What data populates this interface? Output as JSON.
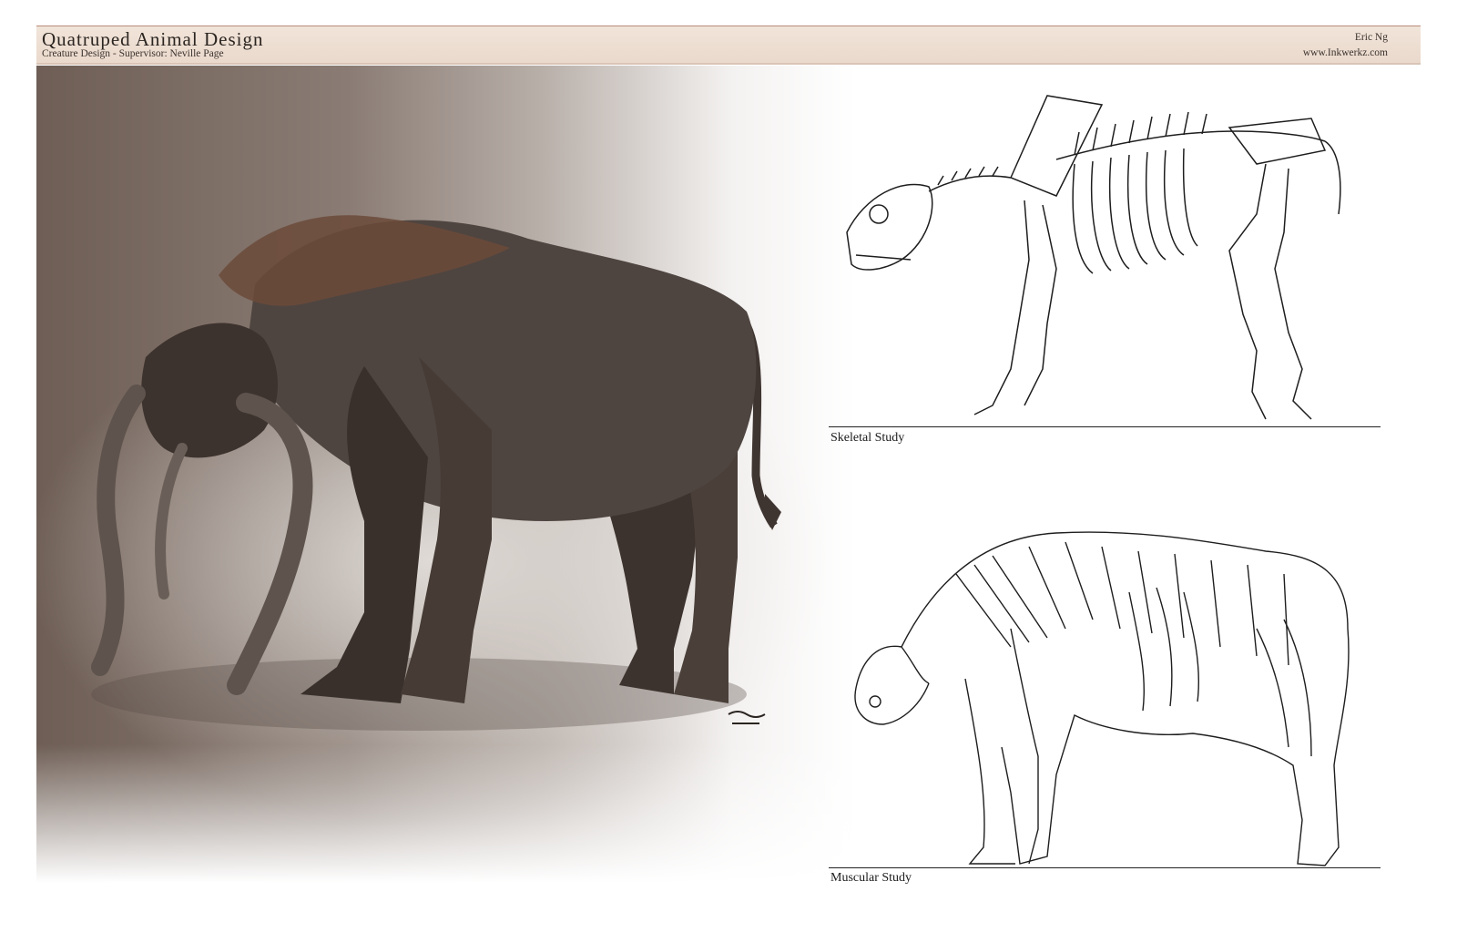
{
  "header": {
    "title": "Quatruped Animal Design",
    "subtitle": "Creature Design - Supervisor: Neville Page",
    "author": "Eric Ng",
    "website": "www.Inkwerkz.com"
  },
  "studies": {
    "skeletal_caption": "Skeletal Study",
    "muscular_caption": "Muscular Study"
  },
  "colors": {
    "header_band": "#ecdcd0",
    "header_rule": "#b98a78",
    "painting_dark": "#6e5e55",
    "creature_body": "#4a3f39",
    "creature_fur": "#6b4a3a"
  }
}
